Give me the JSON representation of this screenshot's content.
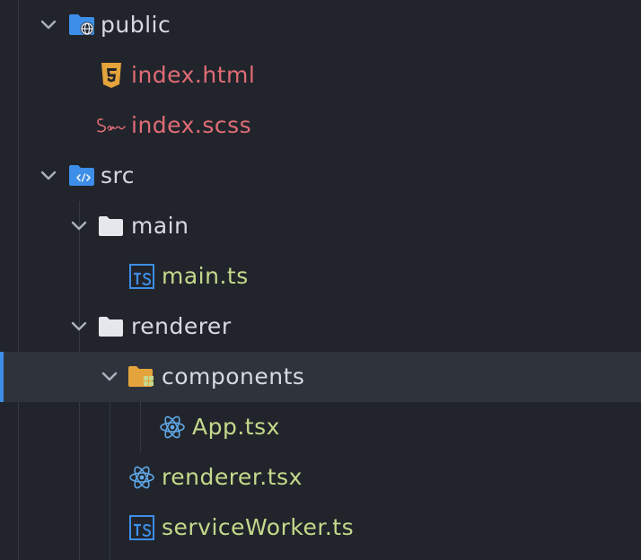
{
  "tree": {
    "items": [
      {
        "label": "public",
        "type": "folder",
        "expanded": true,
        "icon": "folder-public-icon"
      },
      {
        "label": "index.html",
        "type": "file",
        "icon": "html5-icon"
      },
      {
        "label": "index.scss",
        "type": "file",
        "icon": "sass-icon"
      },
      {
        "label": "src",
        "type": "folder",
        "expanded": true,
        "icon": "folder-src-icon"
      },
      {
        "label": "main",
        "type": "folder",
        "expanded": true,
        "icon": "folder-icon"
      },
      {
        "label": "main.ts",
        "type": "file",
        "icon": "typescript-icon"
      },
      {
        "label": "renderer",
        "type": "folder",
        "expanded": true,
        "icon": "folder-icon"
      },
      {
        "label": "components",
        "type": "folder",
        "expanded": true,
        "selected": true,
        "icon": "folder-components-icon"
      },
      {
        "label": "App.tsx",
        "type": "file",
        "icon": "react-icon"
      },
      {
        "label": "renderer.tsx",
        "type": "file",
        "icon": "react-icon"
      },
      {
        "label": "serviceWorker.ts",
        "type": "file",
        "icon": "typescript-icon"
      }
    ]
  },
  "colors": {
    "background": "#21252b",
    "selected_row": "#2f343c",
    "selection_accent": "#3d8ee8",
    "folder_text": "#d7dae0",
    "modified_file_text": "#e06c75",
    "added_file_text": "#c5d88b"
  }
}
